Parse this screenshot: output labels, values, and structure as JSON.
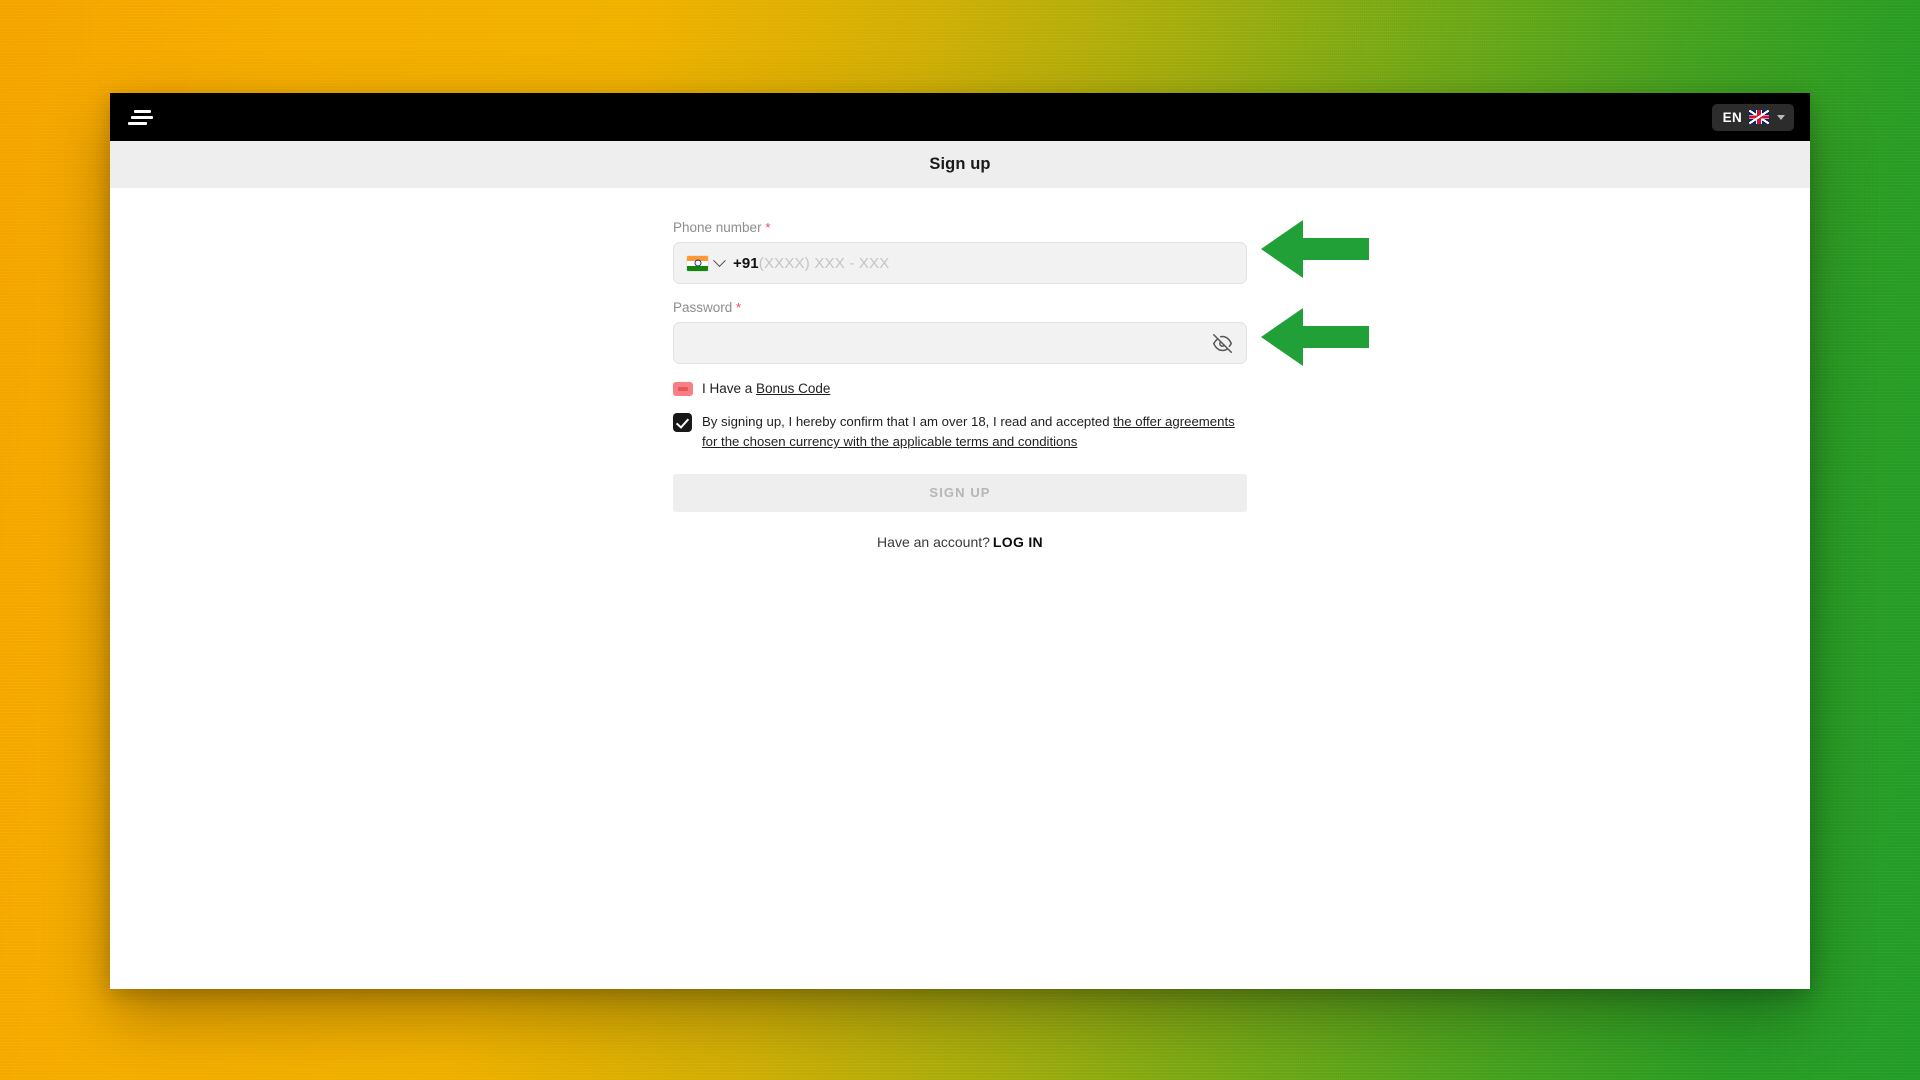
{
  "toolbar": {
    "menu_icon": "hamburger-menu-icon",
    "language": {
      "code": "EN",
      "flag": "uk-flag-icon",
      "caret": "chevron-down-icon"
    }
  },
  "header": {
    "title": "Sign up"
  },
  "form": {
    "phone": {
      "label": "Phone number",
      "required_mark": "*",
      "country_flag": "india-flag-icon",
      "dial_code": "+91",
      "placeholder": "(XXXX) XXX - XXX",
      "value": ""
    },
    "password": {
      "label": "Password",
      "required_mark": "*",
      "value": "",
      "placeholder": "",
      "visibility_icon": "eye-off-icon"
    },
    "bonus": {
      "icon": "ticket-icon",
      "text": "I Have a",
      "link_label": "Bonus Code"
    },
    "terms": {
      "checked": true,
      "text": "By signing up, I hereby confirm that I am over 18, I read and accepted",
      "link_label": "the offer agreements for the chosen currency with the applicable terms and conditions"
    },
    "submit_label": "SIGN UP",
    "login_prompt": "Have an account?",
    "login_label": "LOG IN"
  },
  "annotations": {
    "arrow_color": "#21a038",
    "arrow_1_target": "phone-number-input",
    "arrow_2_target": "password-input"
  },
  "colors": {
    "toolbar_bg": "#000000",
    "titlebar_bg": "#eeeeee",
    "input_bg": "#f2f2f2",
    "required_red": "#f0465a",
    "bonus_pink": "#f97e83",
    "arrow_green": "#21a038",
    "backdrop_left": "#f5a800",
    "backdrop_right": "#26a02a"
  }
}
